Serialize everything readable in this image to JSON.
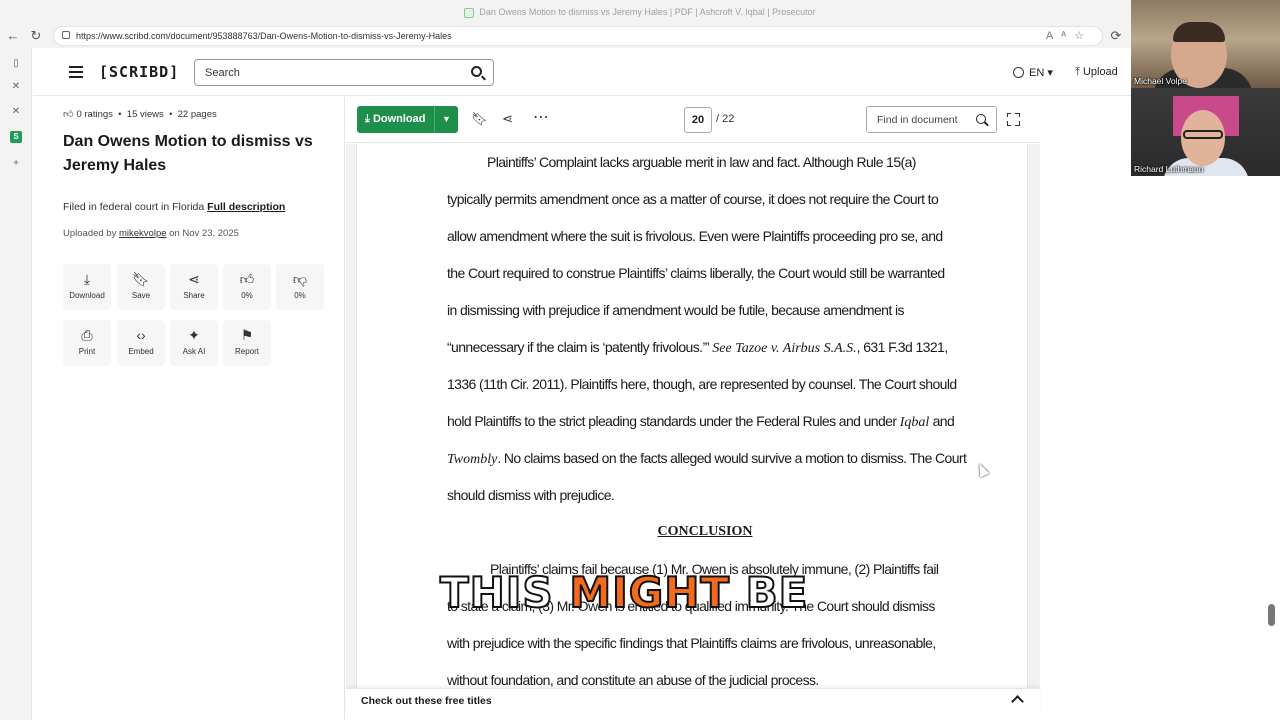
{
  "browser": {
    "window_title": "Dan Owens Motion to dismiss vs Jeremy Hales | PDF | Ashcroft V. Iqbal | Prosecutor",
    "url": "https://www.scribd.com/document/953888763/Dan-Owens-Motion-to-dismiss-vs-Jeremy-Hales"
  },
  "header": {
    "logo": "[SCRIBD]",
    "search_placeholder": "Search",
    "language": "EN",
    "upload_label": "Upload"
  },
  "doc_info": {
    "ratings": "0 ratings",
    "views": "15 views",
    "pages": "22 pages",
    "title": "Dan Owens Motion to dismiss vs Jeremy Hales",
    "filed_text": "Filed in federal court in Florida",
    "full_description": "Full description",
    "uploaded_by_prefix": "Uploaded by",
    "uploader": "mikekvolpe",
    "uploaded_date": "on Nov 23, 2025",
    "actions": [
      {
        "label": "Download",
        "icon": "download-icon"
      },
      {
        "label": "Save",
        "icon": "bookmark-icon"
      },
      {
        "label": "Share",
        "icon": "share-icon"
      },
      {
        "label": "0%",
        "icon": "thumbs-up-icon"
      },
      {
        "label": "0%",
        "icon": "thumbs-down-icon"
      },
      {
        "label": "Print",
        "icon": "print-icon"
      },
      {
        "label": "Embed",
        "icon": "embed-icon"
      },
      {
        "label": "Ask AI",
        "icon": "sparkle-icon"
      },
      {
        "label": "Report",
        "icon": "flag-icon"
      }
    ]
  },
  "toolbar": {
    "download_label": "Download",
    "current_page": "20",
    "total_pages": "/ 22",
    "find_placeholder": "Find in document"
  },
  "document": {
    "lines": [
      "Plaintiffs’ Complaint lacks arguable merit in law and fact. Although Rule 15(a)",
      "typically permits amendment once as a matter of course, it does not require the Court to",
      "allow amendment where the suit is frivolous. Even were Plaintiffs proceeding pro se, and",
      "the Court required to construe Plaintiffs’ claims liberally, the Court would still be warranted",
      "in dismissing with prejudice if amendment would be futile, because amendment is",
      "“unnecessary if the claim is ‘patently frivolous.’”",
      "See Tazoe v. Airbus S.A.S.",
      ", 631 F.3d 1321,",
      "1336 (11th Cir. 2011). Plaintiffs here, though, are represented by counsel. The Court should",
      "hold Plaintiffs to the strict pleading standards under the Federal Rules and under",
      "Iqbal",
      "and",
      "Twombly",
      ". No claims based on the facts alleged would survive a motion to dismiss. The Court",
      "should dismiss with prejudice."
    ],
    "conclusion_heading": "CONCLUSION",
    "conclusion_lines": [
      "Plaintiffs’ claims fail because (1) Mr. Owen is absolutely immune, (2) Plaintiffs fail",
      "to state a claim, (3) Mr. Owen is entitled to qualified immunity. The Court should dismiss",
      "with prejudice with the specific findings that Plaintiffs claims are frivolous, unreasonable,",
      "without foundation, and constitute an abuse of the judicial process."
    ]
  },
  "bottom_bar": {
    "label": "Check out these free titles"
  },
  "caption": {
    "word1": "THIS",
    "word2": "MIGHT",
    "word3": "BE"
  },
  "video_call": {
    "participant1": "Michael Volpe",
    "participant2": "Richard Luthmann"
  },
  "colors": {
    "download_green": "#1e8f4a",
    "caption_orange": "#f26a1b"
  }
}
